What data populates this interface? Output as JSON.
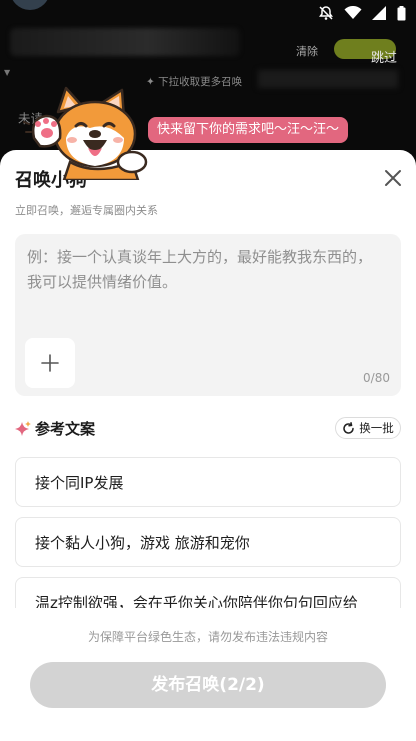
{
  "background": {
    "clear_label": "清除",
    "skip_label": "跳过",
    "pull_hint": "✦ 下拉收取更多召唤",
    "left_text": "未读"
  },
  "mascot": {
    "bubble_text": "快来留下你的需求吧～汪～汪～"
  },
  "sheet": {
    "title": "召唤小狗",
    "subtitle": "立即召唤，邂逅专属圈内关系",
    "input": {
      "placeholder": "例：接一个认真谈年上大方的，最好能教我东西的， 我可以提供情绪价值。",
      "value": "",
      "char_count": "0/80"
    },
    "reference": {
      "title": "参考文案",
      "refresh_label": "换一批",
      "items": [
        "接个同IP发展",
        "接个黏人小狗，游戏 旅游和宠你",
        "温z控制欲强，会在乎你关心你陪伴你句句回应给"
      ]
    },
    "policy_note": "为保障平台绿色生态，请勿发布违法违规内容",
    "publish_label": "发布召唤(2/2)"
  },
  "colors": {
    "bubble": "#e2677f",
    "button_disabled": "#d3d3d3",
    "sparkle": "#e2677f"
  },
  "icons": {
    "close": "close-icon",
    "add": "plus-icon",
    "refresh": "refresh-icon",
    "sparkle": "sparkle-icon",
    "notifications_off": "bell-off-icon",
    "wifi": "wifi-icon",
    "signal": "signal-icon",
    "battery": "battery-icon"
  }
}
